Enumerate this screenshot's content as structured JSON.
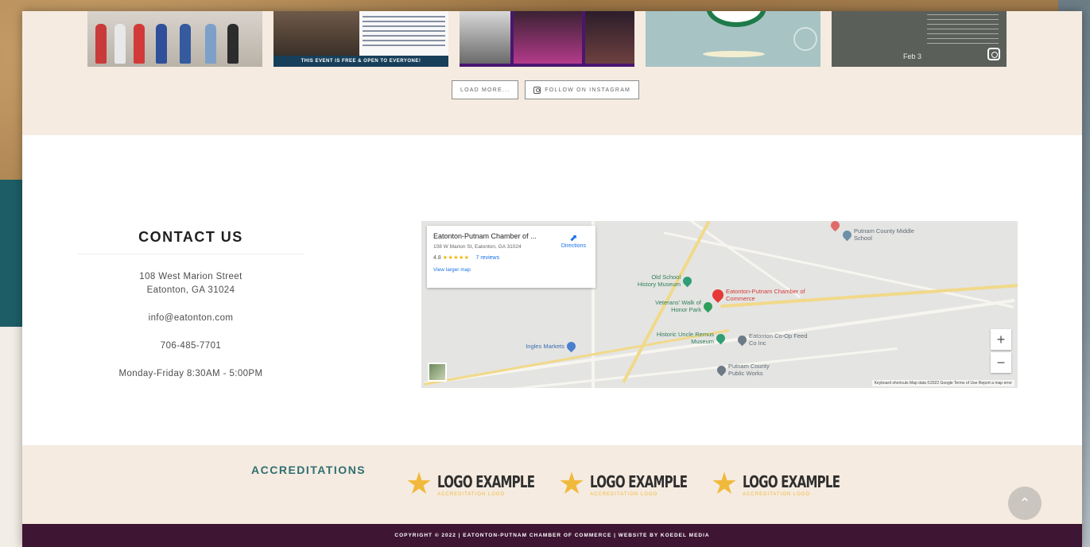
{
  "instagram": {
    "tile2_banner": "THIS EVENT IS FREE & OPEN TO EVERYONE!",
    "tile5_date": "Feb 3",
    "load_more_label": "LOAD MORE...",
    "follow_label": "FOLLOW ON INSTAGRAM"
  },
  "contact": {
    "title": "CONTACT US",
    "address_line1": "108 West Marion Street",
    "address_line2": "Eatonton, GA 31024",
    "email": "info@eatonton.com",
    "phone": "706-485-7701",
    "hours": "Monday-Friday 8:30AM - 5:00PM"
  },
  "map": {
    "place_name": "Eatonton-Putnam Chamber of ...",
    "place_address": "108 W Marion St, Eatonton, GA 31024",
    "rating": "4.8",
    "stars": "★★★★★",
    "reviews": "7 reviews",
    "larger_map": "View larger map",
    "directions": "Directions",
    "zoom_in": "+",
    "zoom_out": "−",
    "footer_text": "Keyboard shortcuts   Map data ©2022 Google   Terms of Use   Report a map error",
    "pois": {
      "putnam_middle": "Putnam County Middle School",
      "old_school": "Old School History Museum",
      "chamber": "Eatonton-Putnam Chamber of Commerce",
      "veterans": "Veterans' Walk of Honor Park",
      "uncle_remus": "Historic Uncle Remus Museum",
      "eatonton_co": "Eatonton Co-Op Feed Co Inc",
      "ingles": "Ingles Markets",
      "public_works": "Putnam County Public Works"
    }
  },
  "accreditations": {
    "title": "ACCREDITATIONS",
    "logos": [
      {
        "main": "LOGO EXAMPLE",
        "sub": "ACCREDITATION LOGO"
      },
      {
        "main": "LOGO EXAMPLE",
        "sub": "ACCREDITATION LOGO"
      },
      {
        "main": "LOGO EXAMPLE",
        "sub": "ACCREDITATION LOGO"
      }
    ]
  },
  "footer": {
    "text": "COPYRIGHT © 2022  |  EATONTON-PUTNAM CHAMBER OF COMMERCE  |  WEBSITE BY KOEDEL MEDIA"
  },
  "colors": {
    "cream": "#f5ebe0",
    "teal_heading": "#2f6f72",
    "footer_bg": "#3e1532",
    "star_gold": "#f1b93b"
  }
}
